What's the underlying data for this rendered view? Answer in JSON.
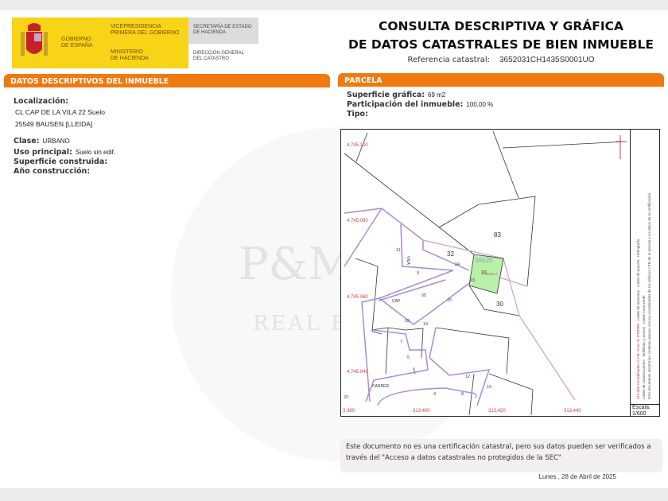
{
  "header": {
    "gov_line1": "GOBIERNO",
    "gov_line2": "DE ESPAÑA",
    "vp_line1": "VICEPRESIDENCIA",
    "vp_line2": "PRIMERA DEL GOBIERNO",
    "min_line1": "MINISTERIO",
    "min_line2": "DE HACIENDA",
    "sec_line1": "SECRETARÍA DE ESTADO",
    "sec_line2": "DE HACIENDA",
    "dg_line1": "DIRECCIÓN GENERAL",
    "dg_line2": "DEL CATASTRO",
    "title_line1": "CONSULTA DESCRIPTIVA Y GRÁFICA",
    "title_line2": "DE DATOS CATASTRALES DE BIEN INMUEBLE",
    "ref_label": "Referencia catastral:",
    "ref_value": "3652031CH1435S0001UO"
  },
  "descriptive": {
    "heading": "DATOS DESCRIPTIVOS DEL INMUEBLE",
    "location_label": "Localización:",
    "address_line1": "CL CAP DE LA VILA 22 Suelo",
    "address_line2": "25549 BAUSEN [LLEIDA]",
    "class_label": "Clase:",
    "class_value": "URBANO",
    "use_label": "Uso principal:",
    "use_value": "Suelo sin edif.",
    "built_area_label": "Superficie construida:",
    "year_label": "Año construcción:"
  },
  "parcel": {
    "heading": "PARCELA",
    "area_label": "Superficie gráfica:",
    "area_value": "69 m2",
    "share_label": "Participación del inmueble:",
    "share_value": "100,00 %",
    "type_label": "Tipo:"
  },
  "map": {
    "y_coords": [
      "4.745.100",
      "4.745.080",
      "4.745.060",
      "4.745.040"
    ],
    "x_coords": [
      "3.380",
      "313.400",
      "313.420",
      "313.440"
    ],
    "parcel_labels": {
      "a": "83",
      "b": "32",
      "c": "30",
      "block": "36520",
      "target": "31",
      "suelo": "SUELO"
    },
    "street_labels": {
      "cap": "CAP",
      "vila": "VILA",
      "carrer": "CARRER"
    },
    "numbers": [
      "11",
      "9",
      "24",
      "16",
      "05",
      "18",
      "14",
      "7",
      "5",
      "12",
      "10",
      "4",
      "8",
      "2",
      "20",
      "23"
    ],
    "legend": {
      "coords": "313.460 Coordenadas U.T.M. Huso 31 ETRS89",
      "items": [
        "Límite de manzana",
        "Límite de parcela",
        "Hidrografía",
        "Límite de construcciones",
        "Mobiliario y aceras",
        "Límite zona verde"
      ],
      "note": "Este documento electrónico contiene anexos con las coordenadas de los vértices UTM de la parcela y los datos de la certificación"
    },
    "scale_label": "Escala:",
    "scale_value": "1/600",
    "colors": {
      "parcel_fill": "#b9f0a8",
      "block_line": "#9b7fd0",
      "parcel_line": "#333333",
      "coord_text": "#d04040"
    }
  },
  "footer": {
    "note_line1": "Este documento no es una certificación catastral, pero sus datos pueden ser verificados a",
    "note_line2": "través del \"Acceso a datos catastrales no protegidos de la SEC\"",
    "date": "Lunes , 28 de Abril de 2025"
  },
  "watermark": {
    "line1": "P&M",
    "line2": "REAL ESTATE"
  },
  "colors": {
    "accent": "#f07a10",
    "logo_yellow": "#f7d417"
  }
}
